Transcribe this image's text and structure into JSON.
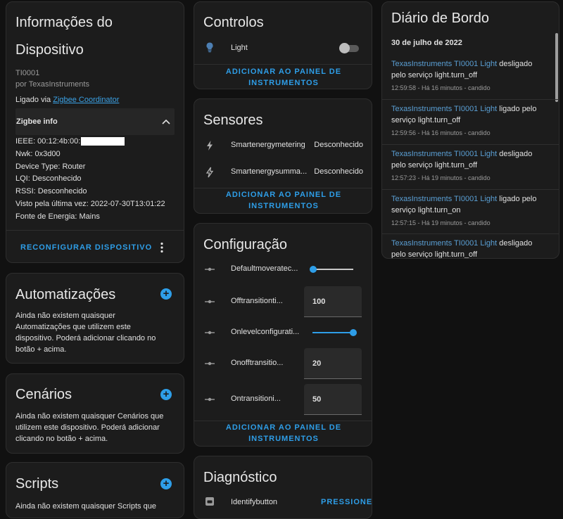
{
  "device_info": {
    "title_line1": "Informações do",
    "title_line2": "Dispositivo",
    "model": "TI0001",
    "manufacturer": "por TexasInstruments",
    "connected_prefix": "Ligado via ",
    "connected_link": "Zigbee Coordinator",
    "zigbee_header": "Zigbee info",
    "zigbee_lines": [
      "IEEE: 00:12:4b:00:",
      "Nwk: 0x3d00",
      "Device Type: Router",
      "LQI: Desconhecido",
      "RSSI: Desconhecido",
      "Visto pela última vez: 2022-07-30T13:01:22",
      "Fonte de Energia: Mains"
    ],
    "reconfigure_label": "RECONFIGURAR DISPOSITIVO"
  },
  "automations": {
    "title": "Automatizações",
    "text": "Ainda não existem quaisquer Automatizações que utilizem este dispositivo. Poderá adicionar clicando no botão + acima."
  },
  "scenes": {
    "title": "Cenários",
    "text": "Ainda não existem quaisquer Cenários que utilizem este dispositivo. Poderá adicionar clicando no botão + acima."
  },
  "scripts": {
    "title": "Scripts",
    "text": "Ainda não existem quaisquer Scripts que"
  },
  "controls": {
    "title": "Controlos",
    "light_label": "Light",
    "light_on": false,
    "add_label": "ADICIONAR AO PAINEL DE INSTRUMENTOS"
  },
  "sensors": {
    "title": "Sensores",
    "rows": [
      {
        "name": "Smartenergymetering",
        "state": "Desconhecido"
      },
      {
        "name": "Smartenergysumma...",
        "state": "Desconhecido"
      }
    ],
    "add_label": "ADICIONAR AO PAINEL DE INSTRUMENTOS"
  },
  "config": {
    "title": "Configuração",
    "rows": [
      {
        "name": "Defaultmoveratec...",
        "type": "slider",
        "value_fraction": 0.0
      },
      {
        "name": "Offtransitionti...",
        "type": "number",
        "value": "100"
      },
      {
        "name": "Onlevelconfigurati...",
        "type": "slider",
        "value_fraction": 1.0
      },
      {
        "name": "Onofftransitio...",
        "type": "number",
        "value": "20"
      },
      {
        "name": "Ontransitioni...",
        "type": "number",
        "value": "50"
      }
    ],
    "add_label": "ADICIONAR AO PAINEL DE INSTRUMENTOS"
  },
  "diagnostics": {
    "title": "Diagnóstico",
    "row_name": "Identifybutton",
    "press_label": "PRESSIONE"
  },
  "logbook": {
    "title": "Diário de Bordo",
    "date": "30 de julho de 2022",
    "entries": [
      {
        "entity": "TexasInstruments TI0001 Light",
        "rest": " desligado pelo serviço light.turn_off",
        "meta": "12:59:58 - Há 16 minutos - candido"
      },
      {
        "entity": "TexasInstruments TI0001 Light",
        "rest": " ligado pelo serviço light.turn_off",
        "meta": "12:59:56 - Há 16 minutos - candido"
      },
      {
        "entity": "TexasInstruments TI0001 Light",
        "rest": " desligado pelo serviço light.turn_off",
        "meta": "12:57:23 - Há 19 minutos - candido"
      },
      {
        "entity": "TexasInstruments TI0001 Light",
        "rest": " ligado pelo serviço light.turn_on",
        "meta": "12:57:15 - Há 19 minutos - candido"
      },
      {
        "entity": "TexasInstruments TI0001 Light",
        "rest": " desligado pelo serviço light.turn_off",
        "meta": ""
      }
    ]
  },
  "colors": {
    "accent": "#2e9ee8",
    "card": "#1c1c1c",
    "background": "#111111"
  }
}
